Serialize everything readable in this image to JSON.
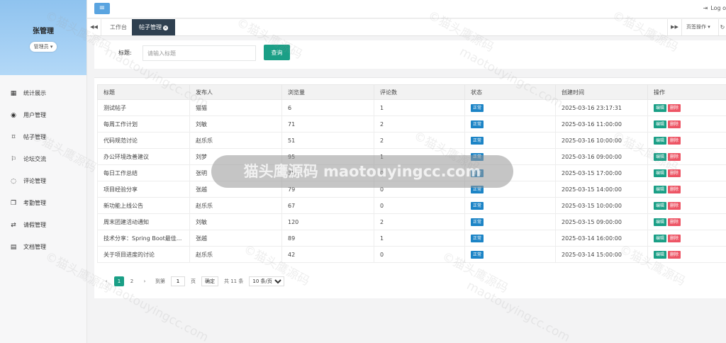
{
  "profile": {
    "name": "张管理",
    "role": "管理员 ▾"
  },
  "sidebar": {
    "items": [
      {
        "icon": "▦",
        "label": "统计展示"
      },
      {
        "icon": "◉",
        "label": "用户管理"
      },
      {
        "icon": "⌑",
        "label": "帖子管理"
      },
      {
        "icon": "⚐",
        "label": "论坛交流"
      },
      {
        "icon": "◌",
        "label": "评论管理"
      },
      {
        "icon": "❐",
        "label": "考勤管理"
      },
      {
        "icon": "⇄",
        "label": "请假管理"
      },
      {
        "icon": "▤",
        "label": "文档管理"
      }
    ]
  },
  "topbar": {
    "menu_icon": "≡",
    "logout_icon": "⇥",
    "logout_label": "Log o"
  },
  "tabs": {
    "left_icon": "◀◀",
    "right_icon": "▶▶",
    "home": "工作台",
    "active": "帖子管理",
    "page_ops": "页签操作 ▾",
    "refresh_icon": "↻"
  },
  "search": {
    "label": "标题:",
    "placeholder": "请输入标题",
    "button": "查询"
  },
  "table": {
    "headers": [
      "标题",
      "发布人",
      "浏览量",
      "评论数",
      "状态",
      "创建时间",
      "操作"
    ],
    "rows": [
      [
        "测试帖子",
        "猫猫",
        "6",
        "1",
        "正常",
        "2025-03-16 23:17:31"
      ],
      [
        "每周工作计划",
        "刘敏",
        "71",
        "2",
        "正常",
        "2025-03-16 11:00:00"
      ],
      [
        "代码规范讨论",
        "赵乐乐",
        "51",
        "2",
        "正常",
        "2025-03-16 10:00:00"
      ],
      [
        "办公环境改善建议",
        "刘梦",
        "95",
        "1",
        "正常",
        "2025-03-16 09:00:00"
      ],
      [
        "每日工作总结",
        "张明",
        "35",
        "0",
        "正常",
        "2025-03-15 17:00:00"
      ],
      [
        "项目经验分享",
        "张越",
        "79",
        "0",
        "正常",
        "2025-03-15 14:00:00"
      ],
      [
        "新功能上线公告",
        "赵乐乐",
        "67",
        "0",
        "正常",
        "2025-03-15 10:00:00"
      ],
      [
        "周末团建活动通知",
        "刘敏",
        "120",
        "2",
        "正常",
        "2025-03-15 09:00:00"
      ],
      [
        "技术分享：Spring Boot最佳...",
        "张越",
        "89",
        "1",
        "正常",
        "2025-03-14 16:00:00"
      ],
      [
        "关于项目进度的讨论",
        "赵乐乐",
        "42",
        "0",
        "正常",
        "2025-03-14 15:00:00"
      ]
    ],
    "edit_label": "编辑",
    "delete_label": "删除"
  },
  "pagination": {
    "prev": "‹",
    "pages": [
      "1",
      "2"
    ],
    "next": "›",
    "goto_label": "到第",
    "goto_value": "1",
    "page_unit": "页",
    "confirm": "确定",
    "total": "共 11 条",
    "page_size": "10 条/页"
  },
  "watermark": {
    "banner": "猫头鹰源码 maotouyingcc.com",
    "tile": "©猫头鹰源码",
    "tile2": "maotouyingcc.com"
  }
}
